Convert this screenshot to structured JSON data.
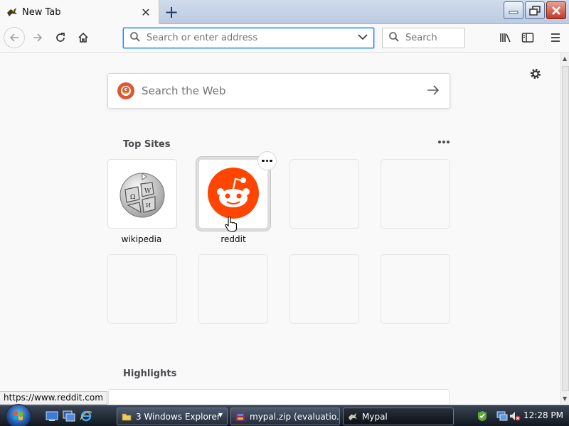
{
  "browser": {
    "tab": {
      "title": "New Tab"
    },
    "url_bar": {
      "placeholder": "Search or enter address"
    },
    "search_bar": {
      "placeholder": "Search"
    }
  },
  "newtab": {
    "web_search": {
      "placeholder": "Search the Web"
    },
    "top_sites": {
      "title": "Top Sites",
      "sites": [
        {
          "label": "wikipedia",
          "icon": "wikipedia-globe-icon"
        },
        {
          "label": "reddit",
          "icon": "reddit-alien-icon"
        }
      ]
    },
    "highlights": {
      "title": "Highlights"
    }
  },
  "status_bar": {
    "text": "https://www.reddit.com"
  },
  "taskbar": {
    "tasks": [
      {
        "label": "3 Windows Explorer"
      },
      {
        "label": "mypal.zip (evaluatio..."
      },
      {
        "label": "Mypal"
      }
    ],
    "clock": "12:28 PM"
  },
  "colors": {
    "reddit": "#ff4500",
    "accent": "#0a84ff",
    "duckduckgo": "#de5833"
  }
}
